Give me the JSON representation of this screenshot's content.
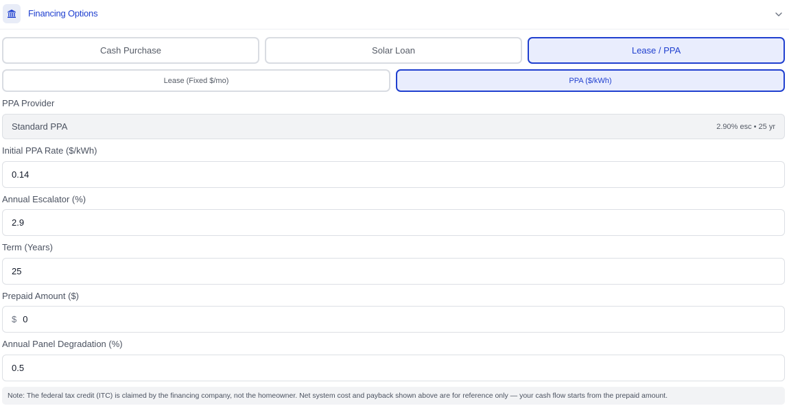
{
  "header": {
    "icon": "bank-icon",
    "title": "Financing Options",
    "chevron": "chevron-down-icon"
  },
  "tabs": [
    {
      "label": "Cash Purchase",
      "active": false
    },
    {
      "label": "Solar Loan",
      "active": false
    },
    {
      "label": "Lease / PPA",
      "active": true
    }
  ],
  "subtabs": [
    {
      "label": "Lease (Fixed $/mo)",
      "active": false
    },
    {
      "label": "PPA ($/kWh)",
      "active": true
    }
  ],
  "provider": {
    "label": "PPA Provider",
    "value": "Standard PPA",
    "meta": "2.90% esc • 25 yr"
  },
  "fields": {
    "rate": {
      "label": "Initial PPA Rate ($/kWh)",
      "value": "0.14"
    },
    "escalator": {
      "label": "Annual Escalator (%)",
      "value": "2.9"
    },
    "term": {
      "label": "Term (Years)",
      "value": "25"
    },
    "prepaid": {
      "label": "Prepaid Amount ($)",
      "prefix": "$",
      "value": "0"
    },
    "degradation": {
      "label": "Annual Panel Degradation (%)",
      "value": "0.5"
    }
  },
  "note": "Note: The federal tax credit (ITC) is claimed by the financing company, not the homeowner. Net system cost and payback shown above are for reference only — your cash flow starts from the prepaid amount.",
  "colors": {
    "accent": "#1f3fcf",
    "active_bg": "#e9edfd",
    "border": "#d9dce2"
  }
}
